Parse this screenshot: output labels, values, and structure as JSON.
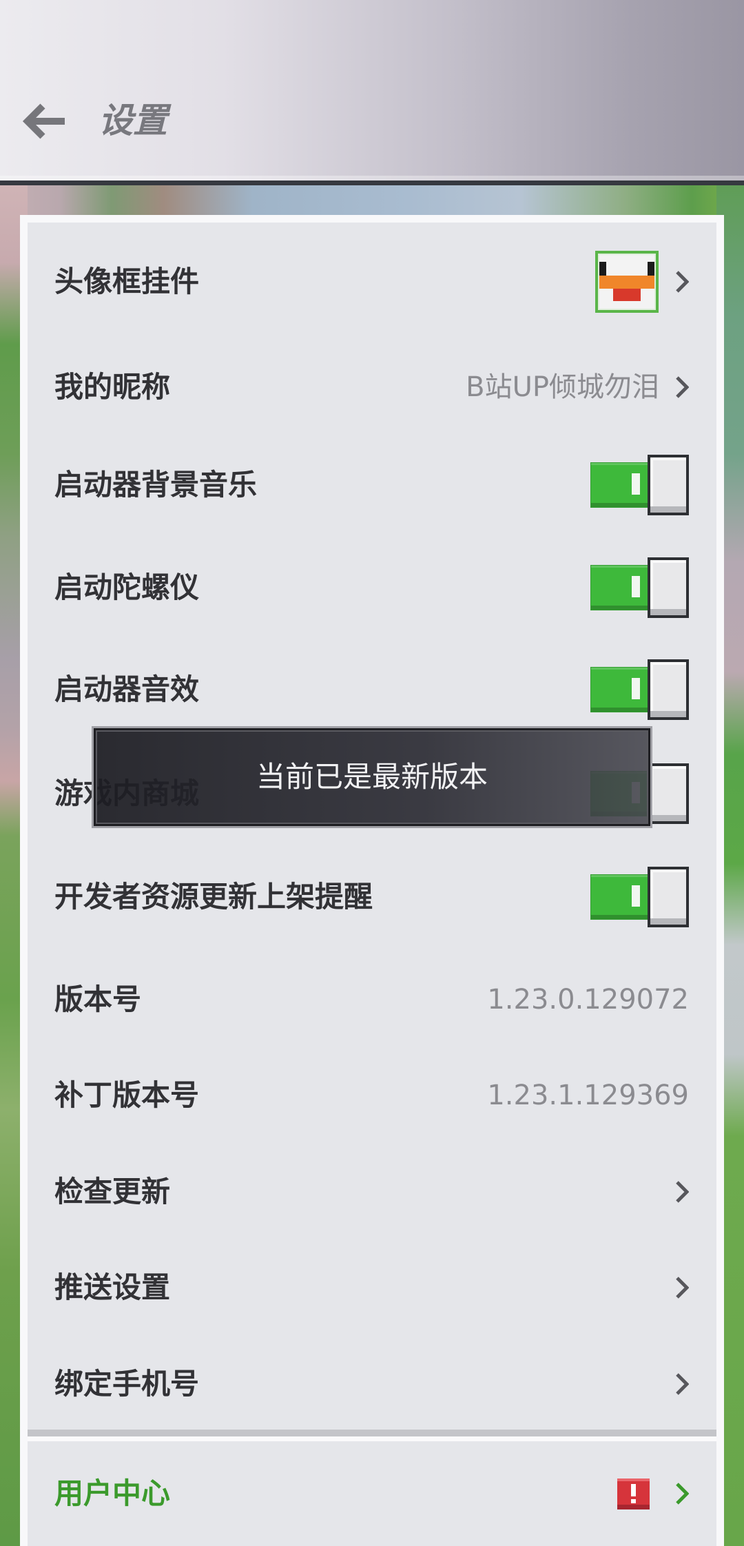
{
  "header": {
    "title": "设置",
    "back_icon": "arrow-left-icon"
  },
  "settings": {
    "rows": [
      {
        "label": "头像框挂件",
        "icon": "chicken-avatar-frame-icon",
        "chevron": true
      },
      {
        "label": "我的昵称",
        "value": "B站UP倾城勿泪",
        "chevron": true
      },
      {
        "label": "启动器背景音乐",
        "on": true
      },
      {
        "label": "启动陀螺仪",
        "on": true
      },
      {
        "label": "启动器音效",
        "on": true
      },
      {
        "label": "游戏内商城",
        "on": true
      },
      {
        "label": "开发者资源更新上架提醒",
        "on": true
      },
      {
        "label": "版本号",
        "value": "1.23.0.129072"
      },
      {
        "label": "补丁版本号",
        "value": "1.23.1.129369"
      },
      {
        "label": "检查更新",
        "chevron": true
      },
      {
        "label": "推送设置",
        "chevron": true
      },
      {
        "label": "绑定手机号",
        "chevron": true
      }
    ]
  },
  "user_center": {
    "label": "用户中心",
    "badge_icon": "exclamation-badge-icon",
    "chevron": true
  },
  "toast": {
    "message": "当前已是最新版本"
  },
  "colors": {
    "panel": "#e5e6ea",
    "toggle_on": "#3eb93b",
    "user_center": "#3b9a2c",
    "badge": "#d6343b",
    "label": "#323236",
    "value": "#8b8b90"
  }
}
